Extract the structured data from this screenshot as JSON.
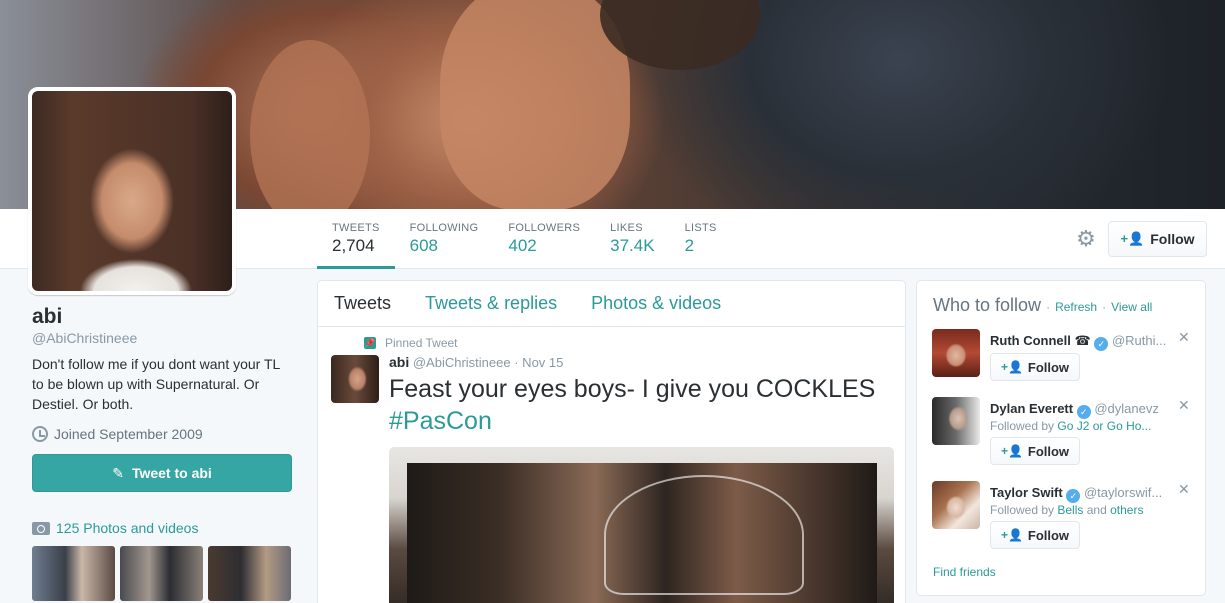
{
  "stats": [
    {
      "label": "TWEETS",
      "value": "2,704"
    },
    {
      "label": "FOLLOWING",
      "value": "608"
    },
    {
      "label": "FOLLOWERS",
      "value": "402"
    },
    {
      "label": "LIKES",
      "value": "37.4K"
    },
    {
      "label": "LISTS",
      "value": "2"
    }
  ],
  "header": {
    "follow_label": "Follow",
    "settings_icon": "gear-icon"
  },
  "profile": {
    "name": "abi",
    "handle": "@AbiChristineee",
    "bio": "Don't follow me if you dont want your TL to be blown up with Supernatural. Or Destiel. Or both.",
    "joined": "Joined September 2009",
    "tweet_to_label": "Tweet to abi",
    "photos_label": "125 Photos and videos"
  },
  "tabs": [
    "Tweets",
    "Tweets & replies",
    "Photos & videos"
  ],
  "pinned_tweet": {
    "pinned_label": "Pinned Tweet",
    "name": "abi",
    "handle": "@AbiChristineee",
    "date": "· Nov 15",
    "text": "Feast your eyes boys- I give you COCKLES",
    "hashtag": "#PasCon"
  },
  "who_to_follow": {
    "title": "Who to follow",
    "refresh": "Refresh",
    "view_all": "View all",
    "find_friends": "Find friends",
    "suggestions": [
      {
        "name": "Ruth Connell",
        "badge": "☎",
        "handle": "@Ruthi...",
        "followed_by_prefix": "",
        "followed_by": "",
        "follow_label": "Follow"
      },
      {
        "name": "Dylan Everett",
        "badge": "",
        "handle": "@dylanevz",
        "followed_by_prefix": "Followed by",
        "followed_by": "Go J2 or Go Ho...",
        "follow_label": "Follow"
      },
      {
        "name": "Taylor Swift",
        "badge": "",
        "handle": "@taylorswif...",
        "followed_by_prefix": "Followed by",
        "followed_by": "Bells",
        "followed_by_and": "and",
        "followed_by_others": "others",
        "follow_label": "Follow"
      }
    ]
  },
  "colors": {
    "accent": "#2b9a98",
    "tweet_button": "#35a6a3"
  }
}
